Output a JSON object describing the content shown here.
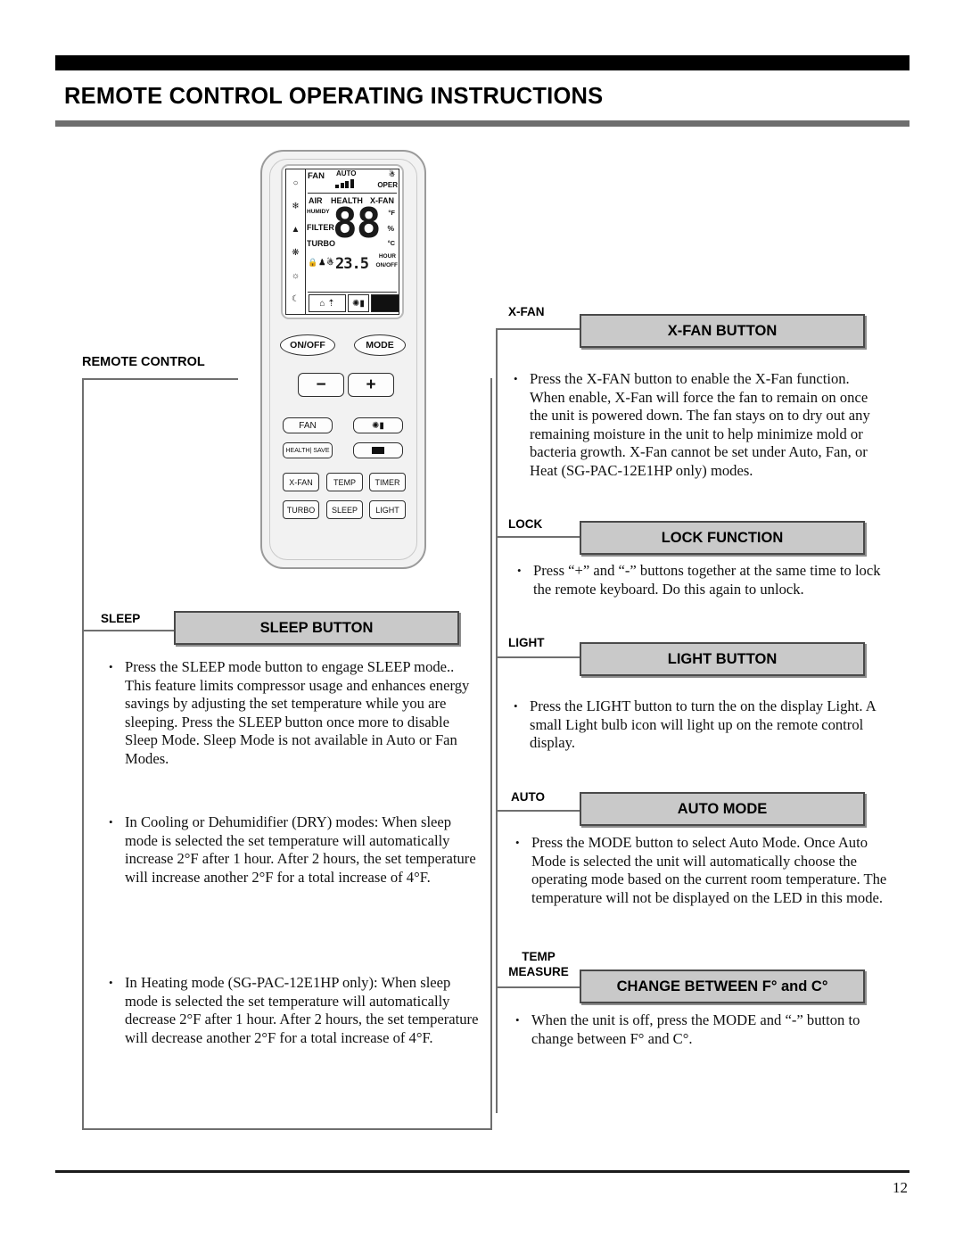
{
  "header": {
    "title": "REMOTE CONTROL OPERATING INSTRUCTIONS"
  },
  "footer": {
    "page_number": "12"
  },
  "remote": {
    "lcd": {
      "fan": "FAN",
      "auto": "AUTO",
      "oper": "OPER",
      "air": "AIR",
      "health": "HEALTH",
      "x_fan": "X-FAN",
      "humidy": "HUMIDY",
      "filter": "FILTER",
      "turbo": "TURBO",
      "deg_f": "°F",
      "percent": "%",
      "deg_c": "°C",
      "hour": "HOUR",
      "on_off": "ON/OFF",
      "big_digits": "88",
      "small_digits": "23.5",
      "rail_icons": [
        "water-drop-icon",
        "snowflake-icon",
        "dry-icon",
        "fan-blade-icon",
        "sun-icon",
        "moon-icon"
      ],
      "lock_row_icons": [
        "lock-icon",
        "person-icon",
        "bulb-icon"
      ]
    },
    "buttons": {
      "on_off": "ON/OFF",
      "mode": "MODE",
      "minus": "−",
      "plus": "+",
      "fan": "FAN",
      "health_save": "HEALTH| SAVE",
      "x_fan": "X-FAN",
      "temp": "TEMP",
      "timer": "TIMER",
      "turbo": "TURBO",
      "sleep": "SLEEP",
      "light": "LIGHT",
      "swing_vertical": "swing-vertical-icon",
      "swing_horizontal": "swing-horizontal-icon"
    }
  },
  "left_column": {
    "remote_control_tag": "REMOTE CONTROL",
    "sections": [
      {
        "tag": "SLEEP",
        "bar_title": "SLEEP BUTTON",
        "paragraphs": [
          "Press the SLEEP mode button to engage SLEEP mode.. This feature limits compressor usage and enhances energy savings by adjusting the set temperature while you are sleeping. Press the SLEEP button once more to disable Sleep Mode. Sleep Mode is not available in Auto or Fan Modes.",
          "In Cooling or Dehumidifier (DRY) modes:  When sleep mode is selected the set temperature will automatically increase 2°F after 1 hour. After 2 hours, the set temperature will increase another 2°F for a total increase of 4°F.",
          "In Heating mode (SG-PAC-12E1HP only):  When sleep mode is selected the set temperature will automatically decrease 2°F after 1 hour. After 2 hours, the set temperature will decrease another 2°F for a total increase of 4°F."
        ]
      }
    ]
  },
  "right_column": {
    "sections": [
      {
        "tag": "X-FAN",
        "bar_title": "X-FAN BUTTON",
        "paragraphs": [
          "Press the X-FAN button to enable the X-Fan function. When enable, X-Fan will force the fan to remain on once the unit is powered down. The fan stays on to dry out any remaining moisture in the unit to help minimize mold or bacteria growth. X-Fan cannot be set under Auto, Fan, or Heat (SG-PAC-12E1HP only) modes."
        ]
      },
      {
        "tag": "LOCK",
        "bar_title": "LOCK FUNCTION",
        "paragraphs": [
          "Press “+” and “-” buttons together at the same time to lock the remote keyboard. Do this again to unlock."
        ]
      },
      {
        "tag": "LIGHT",
        "bar_title": "LIGHT BUTTON",
        "paragraphs": [
          "Press the LIGHT button to turn the on the display Light. A small Light bulb icon will light up on the remote control display."
        ]
      },
      {
        "tag": "AUTO",
        "bar_title": "AUTO MODE",
        "paragraphs": [
          "Press the MODE button to select Auto Mode. Once Auto Mode is selected the unit will automatically choose the operating mode based on the current room temperature. The temperature will not be displayed on the LED in this mode."
        ]
      },
      {
        "tag": "TEMP MEASURE",
        "tag_line1": "TEMP",
        "tag_line2": "MEASURE",
        "bar_title": "CHANGE BETWEEN F° and C°",
        "paragraphs": [
          "When the unit is off, press the MODE and “-” button to change between F° and C°."
        ]
      }
    ]
  },
  "colors": {
    "header_bar": "#000000",
    "header_rule": "#6e6e6e",
    "callout_bar_fill": "#c9c9c9",
    "callout_border": "#4a4a4a",
    "bracket_line": "#6f6f6f"
  }
}
